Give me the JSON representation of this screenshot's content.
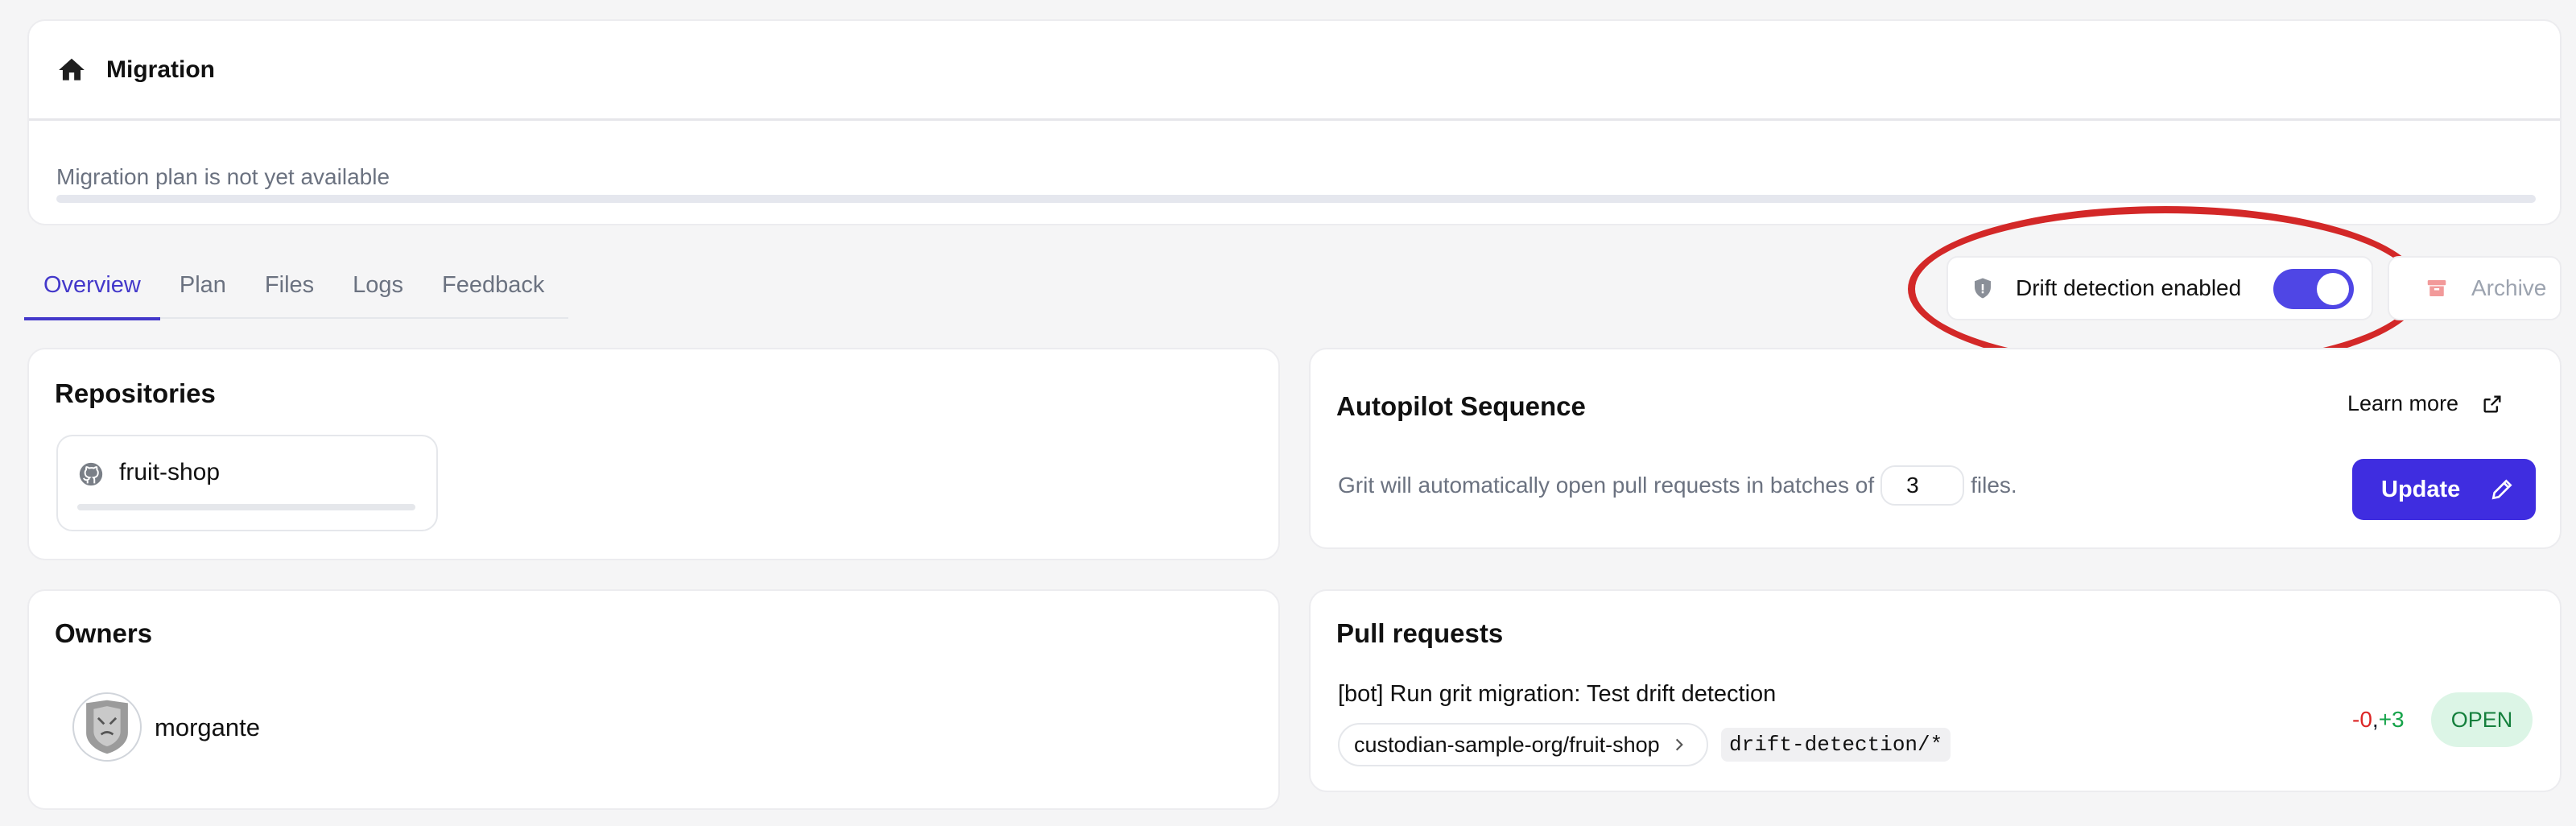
{
  "header": {
    "title": "Migration",
    "plan_status": "Migration plan is not yet available",
    "plan_progress": 0
  },
  "tabs": [
    {
      "label": "Overview",
      "active": true
    },
    {
      "label": "Plan",
      "active": false
    },
    {
      "label": "Files",
      "active": false
    },
    {
      "label": "Logs",
      "active": false
    },
    {
      "label": "Feedback",
      "active": false
    }
  ],
  "drift": {
    "label": "Drift detection enabled",
    "enabled": true
  },
  "archive": {
    "label": "Archive"
  },
  "repositories": {
    "title": "Repositories",
    "items": [
      {
        "name": "fruit-shop",
        "icon": "github-icon"
      }
    ]
  },
  "autopilot": {
    "title": "Autopilot Sequence",
    "learn_more": "Learn more",
    "text_before": "Grit will automatically open pull requests in batches of",
    "batch_size": "3",
    "text_after": "files.",
    "update_label": "Update"
  },
  "owners": {
    "title": "Owners",
    "items": [
      {
        "name": "morgante"
      }
    ]
  },
  "pull_requests": {
    "title": "Pull requests",
    "items": [
      {
        "title": "[bot] Run grit migration: Test drift detection",
        "repo": "custodian-sample-org/fruit-shop",
        "branch": "drift-detection/*",
        "deletions": "-0",
        "separator": ",",
        "additions": "+3",
        "status": "OPEN"
      }
    ]
  },
  "colors": {
    "accent": "#4f46e5",
    "annotation": "#d32828",
    "deletion": "#dc2626",
    "addition": "#16a34a",
    "open_badge_bg": "#dcf5e6"
  }
}
